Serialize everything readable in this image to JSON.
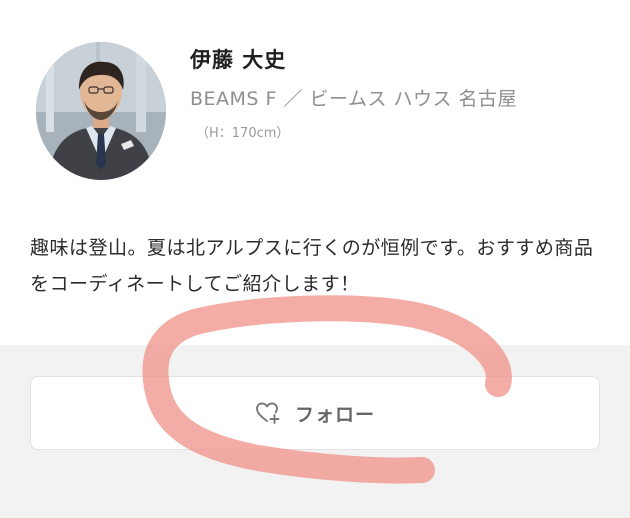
{
  "profile": {
    "name": "伊藤 大史",
    "shop": "BEAMS F ／ ビームス ハウス 名古屋",
    "height": "（H：170cm）",
    "bio": "趣味は登山。夏は北アルプスに行くのが恒例です。おすすめ商品をコーディネートしてご紹介します！",
    "avatar_icon": "staff-photo"
  },
  "follow_button": {
    "label": "フォロー",
    "icon": "heart-plus-icon"
  },
  "colors": {
    "annotation_stroke": "#f08c84",
    "footer_background": "#f2f2f2",
    "secondary_text": "#8f8f8f"
  }
}
